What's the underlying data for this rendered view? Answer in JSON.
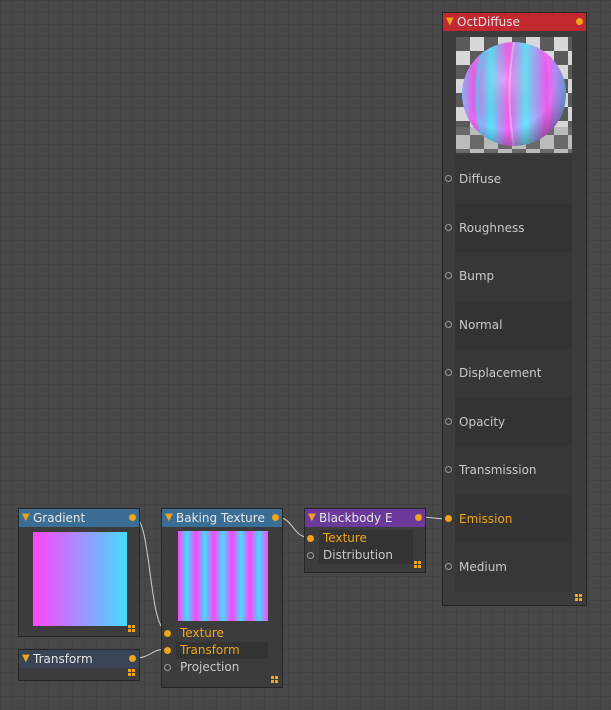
{
  "nodes": {
    "gradient": {
      "title": "Gradient",
      "header_color": "#3b6e95"
    },
    "transform": {
      "title": "Transform",
      "header_color": "#3a4457"
    },
    "baking": {
      "title": "Baking Texture",
      "header_color": "#3b6e95",
      "pins": [
        {
          "label": "Texture",
          "connected": true
        },
        {
          "label": "Transform",
          "connected": true
        },
        {
          "label": "Projection",
          "connected": false
        }
      ]
    },
    "blackbody": {
      "title": "Blackbody E",
      "header_color": "#6b3a9a",
      "pins": [
        {
          "label": "Texture",
          "connected": true
        },
        {
          "label": "Distribution",
          "connected": false
        }
      ]
    },
    "octdiffuse": {
      "title": "OctDiffuse",
      "header_color": "#c2282f",
      "pins": [
        {
          "label": "Diffuse",
          "connected": false
        },
        {
          "label": "Roughness",
          "connected": false
        },
        {
          "label": "Bump",
          "connected": false
        },
        {
          "label": "Normal",
          "connected": false
        },
        {
          "label": "Displacement",
          "connected": false
        },
        {
          "label": "Opacity",
          "connected": false
        },
        {
          "label": "Transmission",
          "connected": false
        },
        {
          "label": "Emission",
          "connected": true
        },
        {
          "label": "Medium",
          "connected": false
        }
      ]
    }
  },
  "colors": {
    "accent": "#f2a51a",
    "grid_background": "#484848",
    "node_body": "#3c3c3c",
    "gradient_from": "#ff44ff",
    "gradient_to": "#44ddff"
  }
}
